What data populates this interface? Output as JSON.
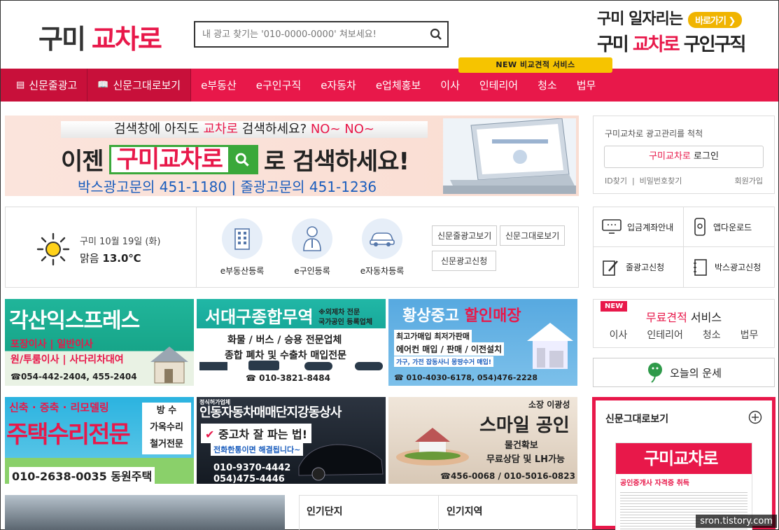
{
  "logo": {
    "part1": "구미",
    "part2": "교차로"
  },
  "search": {
    "placeholder": "내 광고 찾기는 '010-0000-0000' 쳐보세요!"
  },
  "top_ad": {
    "line1": "구미 일자리는",
    "go_label": "바로가기 ❯",
    "line2a": "구미 ",
    "line2b": "교차로",
    "line2c": " 구인구직"
  },
  "nav": {
    "items": [
      "신문줄광고",
      "신문그대로보기",
      "e부동산",
      "e구인구직",
      "e자동차",
      "e업체홍보",
      "이사",
      "인테리어",
      "청소",
      "법무"
    ],
    "new_tab": "NEW 비교견적 서비스"
  },
  "banner": {
    "q_a": "검색창에 아직도 ",
    "q_b": "교차로",
    "q_c": " 검색하세요? ",
    "q_d": "NO~ NO~",
    "main_a": "이젠",
    "main_box": "구미교차로",
    "main_b": "로 검색하세요!",
    "phones": "박스광고문의 451-1180  |  줄광고문의 451-1236"
  },
  "weather": {
    "date": "구미 10월 19일 (화)",
    "cond": "맑음",
    "temp": "13.0℃"
  },
  "register": [
    "e부동산등록",
    "e구인등록",
    "e자동차등록"
  ],
  "quick_btns": [
    "신문줄광고보기",
    "신문그대로보기",
    "신문광고신청"
  ],
  "ads": [
    {
      "title": "각산익스프레스",
      "l1": "포장이사 | 일반이사",
      "l2": "원/투룸이사 | 사다리차대여",
      "phone": "☎054-442-2404, 455-2404"
    },
    {
      "title": "서대구종합무역",
      "note1": "※외제차 전문",
      "note2": "국가공인 등록업체",
      "l1": "화물 / 버스 / 승용 전문업체",
      "l2": "종합 폐차 및 수출차 매입전문",
      "phone": "☎ 010-3821-8484"
    },
    {
      "title_a": "황상중고",
      "title_b": "할인매장",
      "l1": "최고가매입 최저가판매",
      "l2": "에어컨 매입 / 판매 / 이전설치",
      "l3": "가구, 가전 잡동사니 몽땅수거 매입!",
      "phone": "☎ 010-4030-6178, 054)476-2228"
    },
    {
      "top": "신축 · 증축 · 리모델링",
      "title": "주택수리전문",
      "side": "방 수\n가옥수리\n철거전문",
      "phone": "010-2638-0035 동원주택"
    },
    {
      "small": "정식허가업체",
      "title": "인동자동차매매단지강동상사",
      "l1": "중고차 잘 파는 법!",
      "l2": "전화한통이면 해결됩니다~",
      "phone1": "010-9370-4442",
      "phone2": "054)475-4446"
    },
    {
      "owner": "소장 이광성",
      "title": "스마일 공인",
      "l1": "물건확보",
      "l2": "무료상담 및 LH가능",
      "phone": "☎456-0068 / 010-5016-0823"
    }
  ],
  "login": {
    "caption": "구미교차로 광고관리를 척척",
    "btn_a": "구미교차로",
    "btn_b": " 로그인",
    "id": "ID찾기",
    "pw": "비밀번호찾기",
    "join": "회원가입"
  },
  "quick": [
    "입금계좌안내",
    "앱다운로드",
    "줄광고신청",
    "박스광고신청"
  ],
  "estimate": {
    "new": "NEW",
    "title_a": "무료견적",
    "title_b": " 서비스",
    "items": [
      "이사",
      "인테리어",
      "청소",
      "법무"
    ]
  },
  "fortune": "오늘의 운세",
  "paper": {
    "title": "신문그대로보기",
    "img_title": "구미교차로",
    "img_sub": "공인중개사 자격증 취득"
  },
  "popular": [
    "인기단지",
    "인기지역"
  ],
  "watermark": "sron.tistory.com"
}
